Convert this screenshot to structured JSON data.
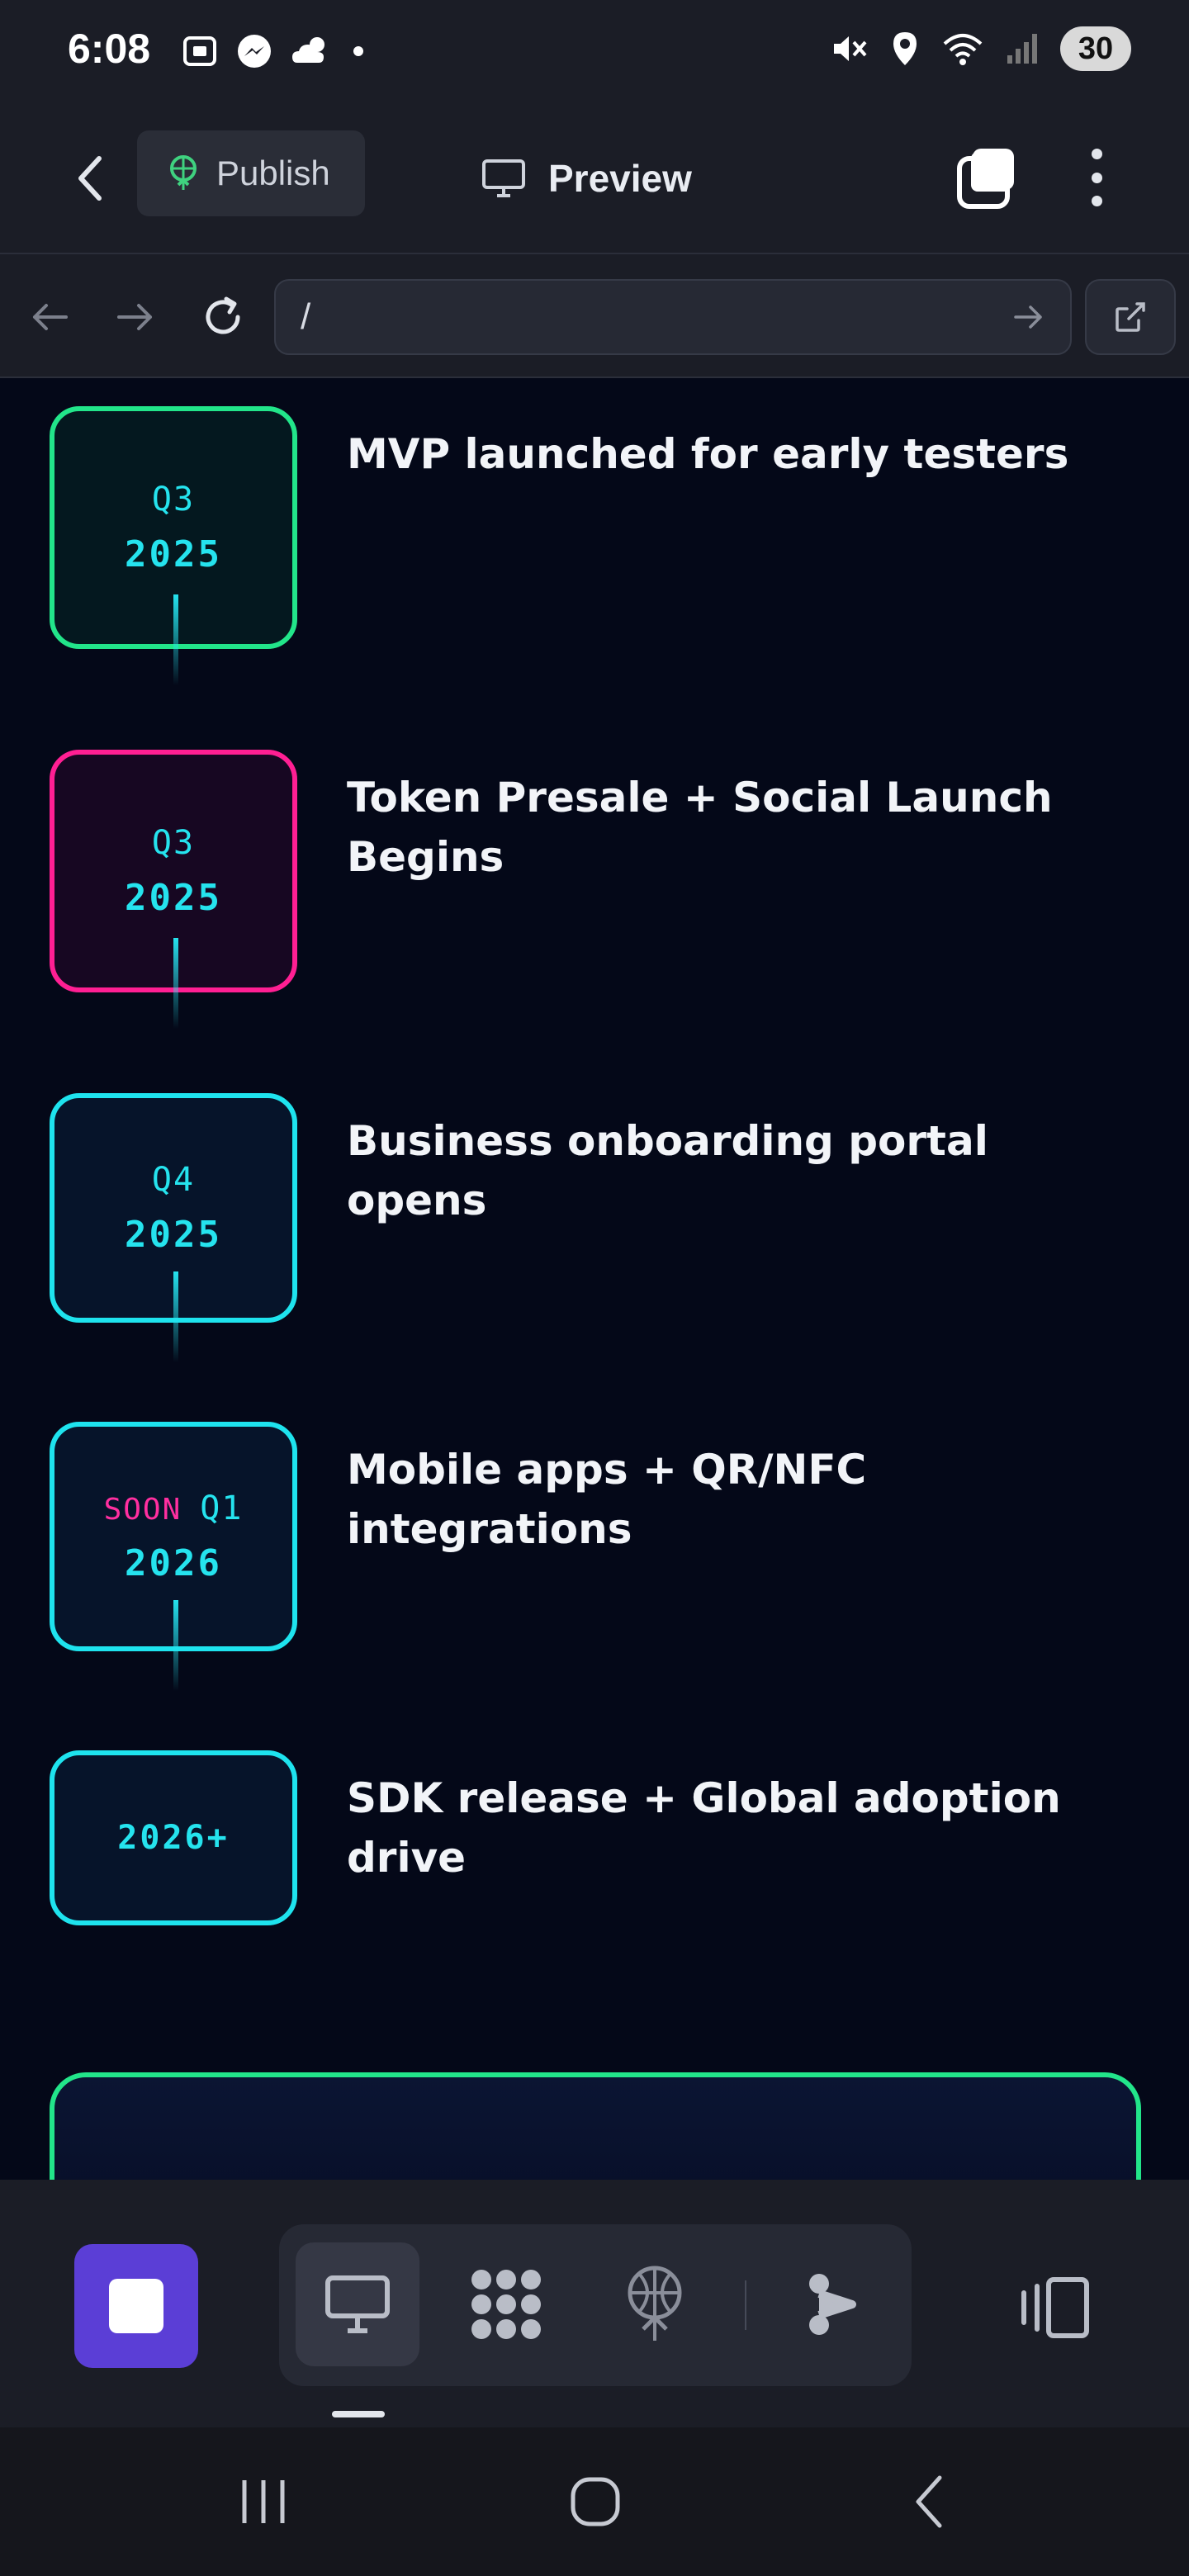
{
  "status_bar": {
    "time": "6:08",
    "battery": "30",
    "left_icons": [
      "screenshot-icon",
      "messenger-icon",
      "weather-icon",
      "dot-icon"
    ],
    "right_icons": [
      "mute-icon",
      "location-icon",
      "wifi-icon",
      "signal-icon"
    ]
  },
  "toolbar": {
    "publish_label": "Publish",
    "preview_label": "Preview"
  },
  "url_bar": {
    "url": "/"
  },
  "roadmap": [
    {
      "quarter": "Q3",
      "year": "2025",
      "soon": "",
      "text": "MVP launched for early testers",
      "style": "green"
    },
    {
      "quarter": "Q3",
      "year": "2025",
      "soon": "",
      "text": "Token Presale + Social Launch Begins",
      "style": "pink"
    },
    {
      "quarter": "Q4",
      "year": "2025",
      "soon": "",
      "text": "Business onboarding portal opens",
      "style": "cyan"
    },
    {
      "quarter": "Q1",
      "year": "2026",
      "soon": "SOON",
      "text": "Mobile apps + QR/NFC integrations",
      "style": "cyan"
    },
    {
      "quarter": "",
      "year": "2026+",
      "soon": "",
      "text": "SDK release + Global adoption drive",
      "style": "cyan"
    }
  ],
  "bottom_tools": [
    "desktop-preview-icon",
    "components-icon",
    "deploy-icon",
    "agent-icon"
  ],
  "colors": {
    "accent_green": "#22e58a",
    "accent_pink": "#ff1f93",
    "accent_cyan": "#1ee3ee",
    "stop_button": "#5b3ed6"
  }
}
